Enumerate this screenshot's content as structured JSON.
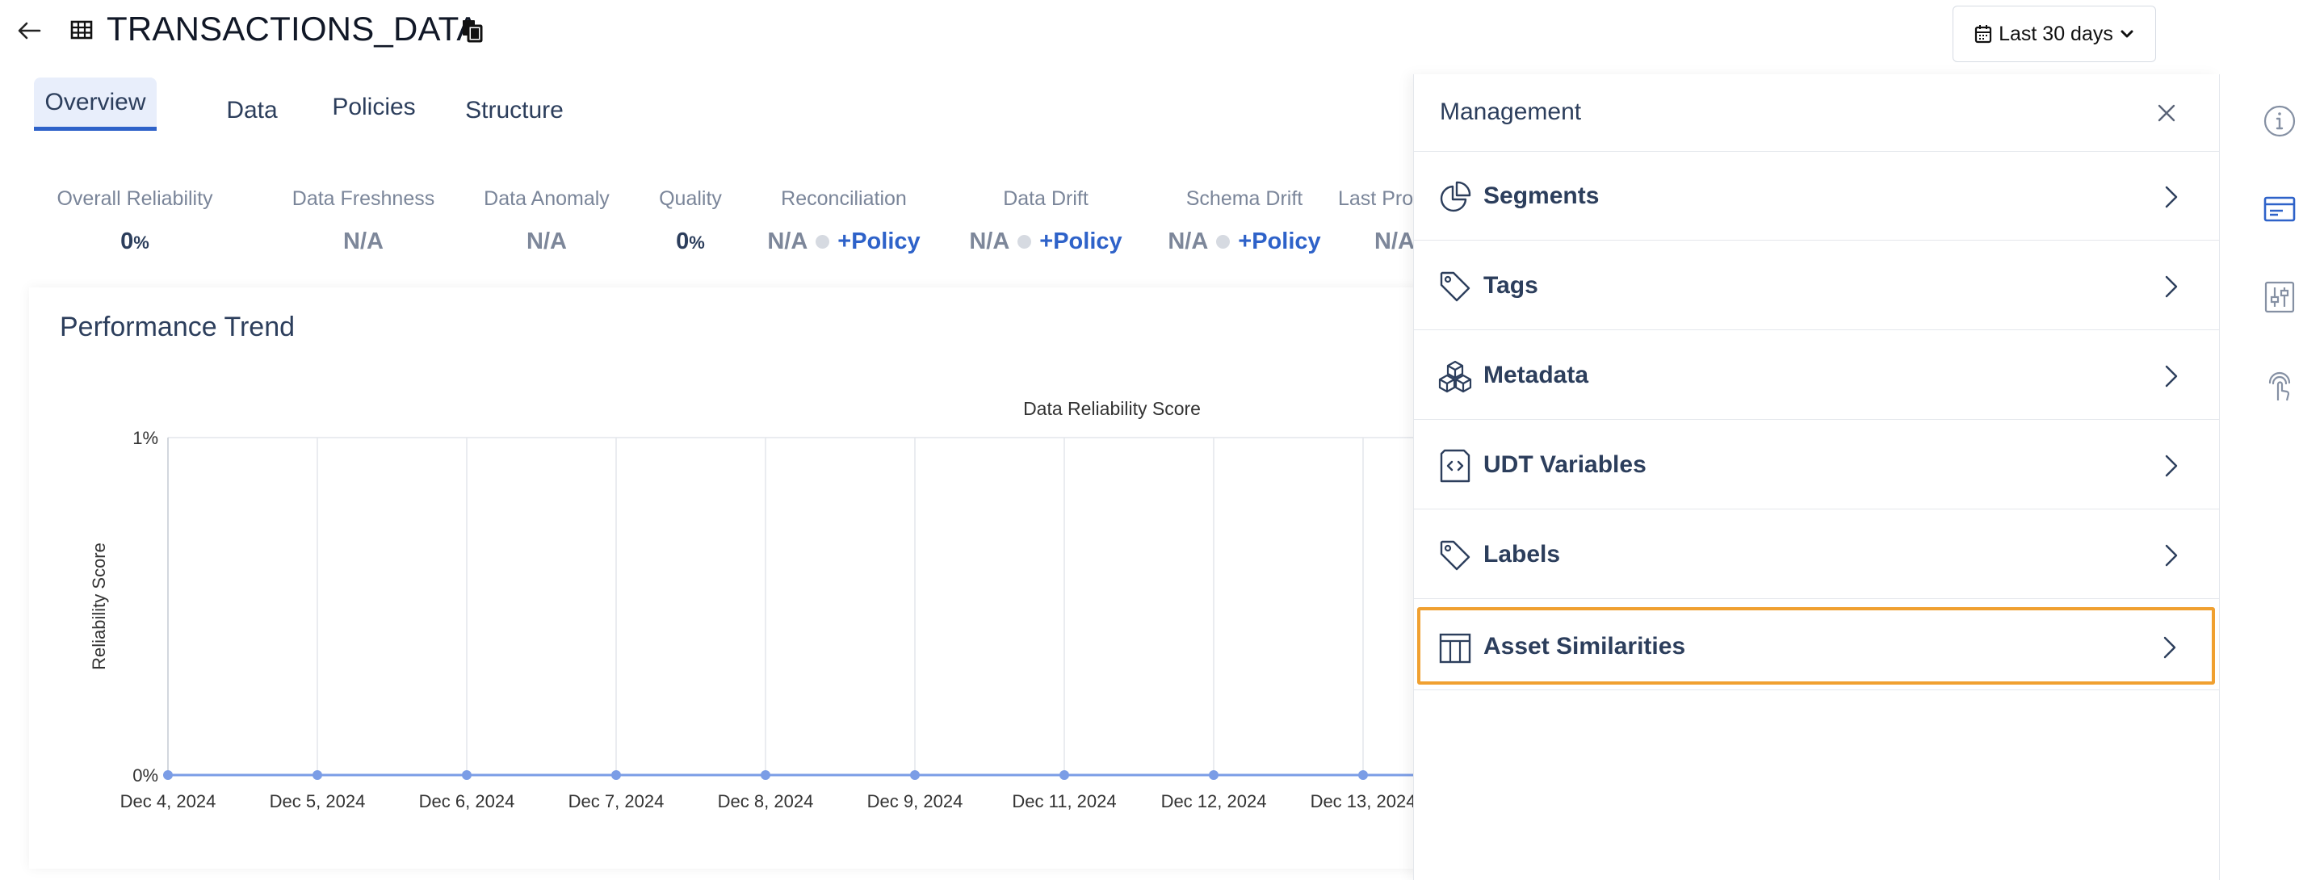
{
  "header": {
    "title": "TRANSACTIONS_DATA",
    "date_range": "Last 30 days"
  },
  "tabs": [
    {
      "label": "Overview",
      "active": true
    },
    {
      "label": "Data",
      "active": false
    },
    {
      "label": "Policies",
      "active": false
    },
    {
      "label": "Structure",
      "active": false
    }
  ],
  "metrics": [
    {
      "label": "Overall Reliability",
      "value": "0",
      "unit": "%"
    },
    {
      "label": "Data Freshness",
      "value": "N/A"
    },
    {
      "label": "Data Anomaly",
      "value": "N/A"
    },
    {
      "label": "Quality",
      "value": "0",
      "unit": "%"
    },
    {
      "label": "Reconciliation",
      "value": "N/A",
      "action": "+Policy"
    },
    {
      "label": "Data Drift",
      "value": "N/A",
      "action": "+Policy"
    },
    {
      "label": "Schema Drift",
      "value": "N/A",
      "action": "+Policy"
    },
    {
      "label": "Last Pro",
      "value": "N/A"
    }
  ],
  "performance": {
    "title": "Performance Trend"
  },
  "chart_data": {
    "type": "line",
    "title": "Data Reliability Score",
    "ylabel": "Reliability Score",
    "xlabel": "",
    "ylim": [
      0,
      1
    ],
    "y_ticks": [
      "0%",
      "1%"
    ],
    "categories": [
      "Dec 4, 2024",
      "Dec 5, 2024",
      "Dec 6, 2024",
      "Dec 7, 2024",
      "Dec 8, 2024",
      "Dec 9, 2024",
      "Dec 11, 2024",
      "Dec 12, 2024",
      "Dec 13, 2024"
    ],
    "series": [
      {
        "values": [
          0,
          0,
          0,
          0,
          0,
          0,
          0,
          0,
          0
        ],
        "color": "#7b9de6"
      }
    ],
    "grid": true
  },
  "management": {
    "title": "Management",
    "items": [
      {
        "label": "Segments",
        "icon": "pie-chart-icon"
      },
      {
        "label": "Tags",
        "icon": "tag-icon"
      },
      {
        "label": "Metadata",
        "icon": "cubes-icon"
      },
      {
        "label": "UDT Variables",
        "icon": "code-icon"
      },
      {
        "label": "Labels",
        "icon": "label-icon"
      },
      {
        "label": "Asset Similarities",
        "icon": "columns-icon",
        "highlighted": true
      }
    ]
  },
  "rail": [
    {
      "icon": "info-icon"
    },
    {
      "icon": "card-icon"
    },
    {
      "icon": "sliders-icon"
    },
    {
      "icon": "touch-icon"
    }
  ],
  "colors": {
    "accent": "#2e62c9",
    "highlight": "#f0a030",
    "text": "#2c3e5c"
  }
}
